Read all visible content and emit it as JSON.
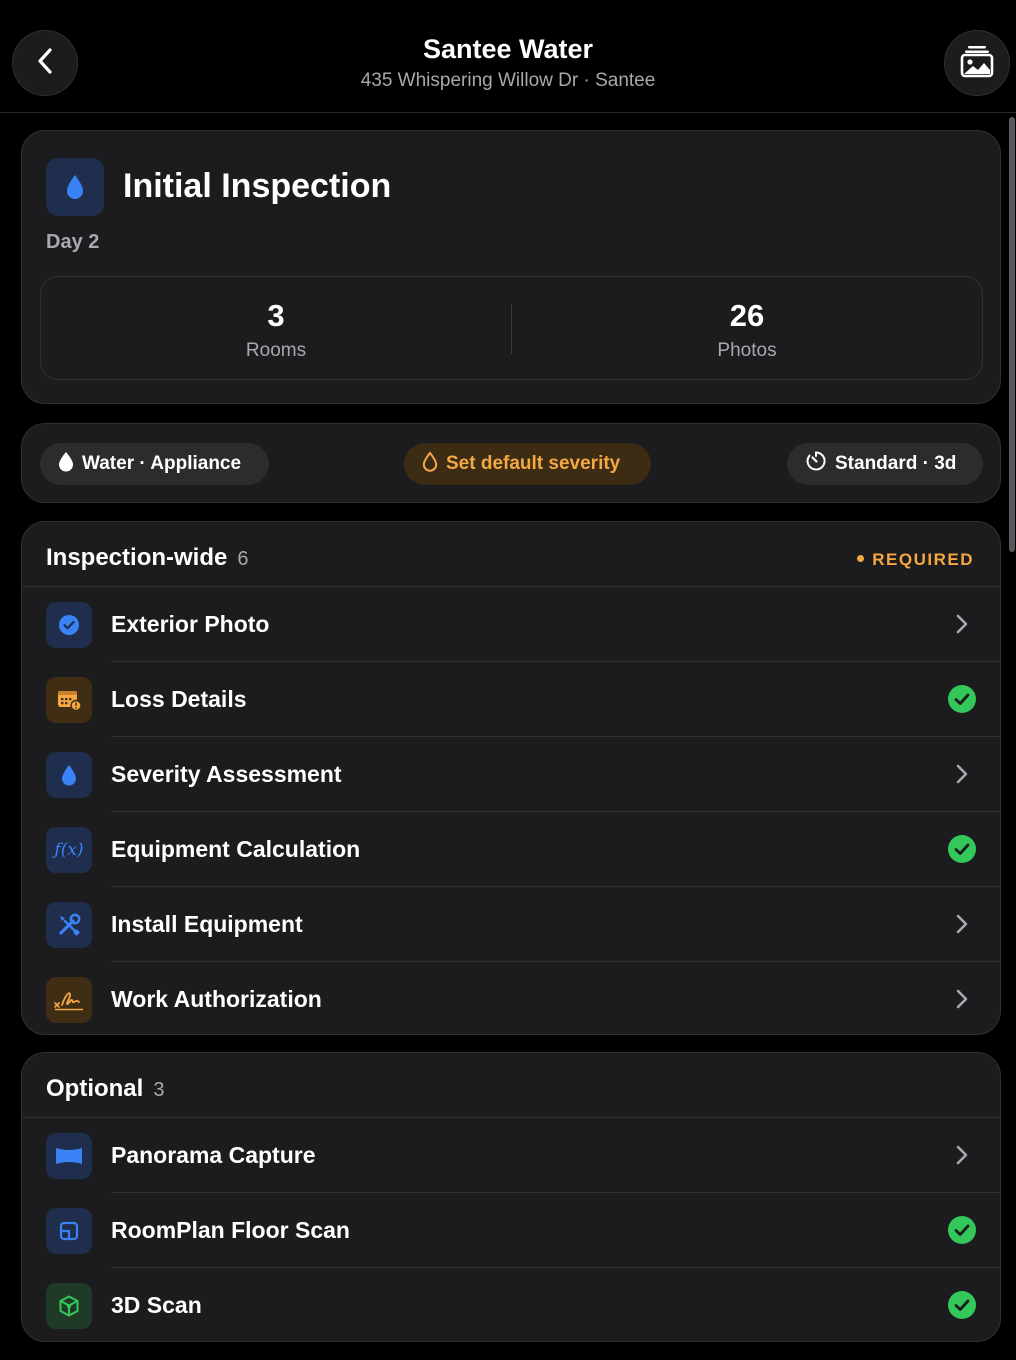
{
  "header": {
    "title": "Santee Water",
    "subtitle": "435 Whispering Willow Dr · Santee"
  },
  "summary": {
    "title": "Initial Inspection",
    "day": "Day 2",
    "stats": [
      {
        "value": "3",
        "label": "Rooms"
      },
      {
        "value": "26",
        "label": "Photos"
      }
    ]
  },
  "chips": {
    "loss_type": "Water · Appliance",
    "severity": "Set default severity",
    "timeline": "Standard · 3d"
  },
  "sections": [
    {
      "title": "Inspection-wide",
      "count": "6",
      "badge": "REQUIRED",
      "items": [
        {
          "label": "Exterior Photo",
          "icon": "checkmark-circle-icon",
          "status": "chevron"
        },
        {
          "label": "Loss Details",
          "icon": "calendar-alert-icon",
          "status": "complete"
        },
        {
          "label": "Severity Assessment",
          "icon": "water-drop-icon",
          "status": "chevron"
        },
        {
          "label": "Equipment Calculation",
          "icon": "function-icon",
          "status": "complete"
        },
        {
          "label": "Install Equipment",
          "icon": "tools-icon",
          "status": "chevron"
        },
        {
          "label": "Work Authorization",
          "icon": "signature-icon",
          "status": "chevron"
        }
      ]
    },
    {
      "title": "Optional",
      "count": "3",
      "items": [
        {
          "label": "Panorama Capture",
          "icon": "panorama-icon",
          "status": "chevron"
        },
        {
          "label": "RoomPlan Floor Scan",
          "icon": "floorplan-icon",
          "status": "complete"
        },
        {
          "label": "3D Scan",
          "icon": "cube-icon",
          "status": "complete"
        }
      ]
    }
  ],
  "colors": {
    "background": "#000000",
    "card": "#1c1c1e",
    "accent_blue": "#3b82f6",
    "accent_amber": "#f4a742",
    "success_green": "#34c759"
  }
}
